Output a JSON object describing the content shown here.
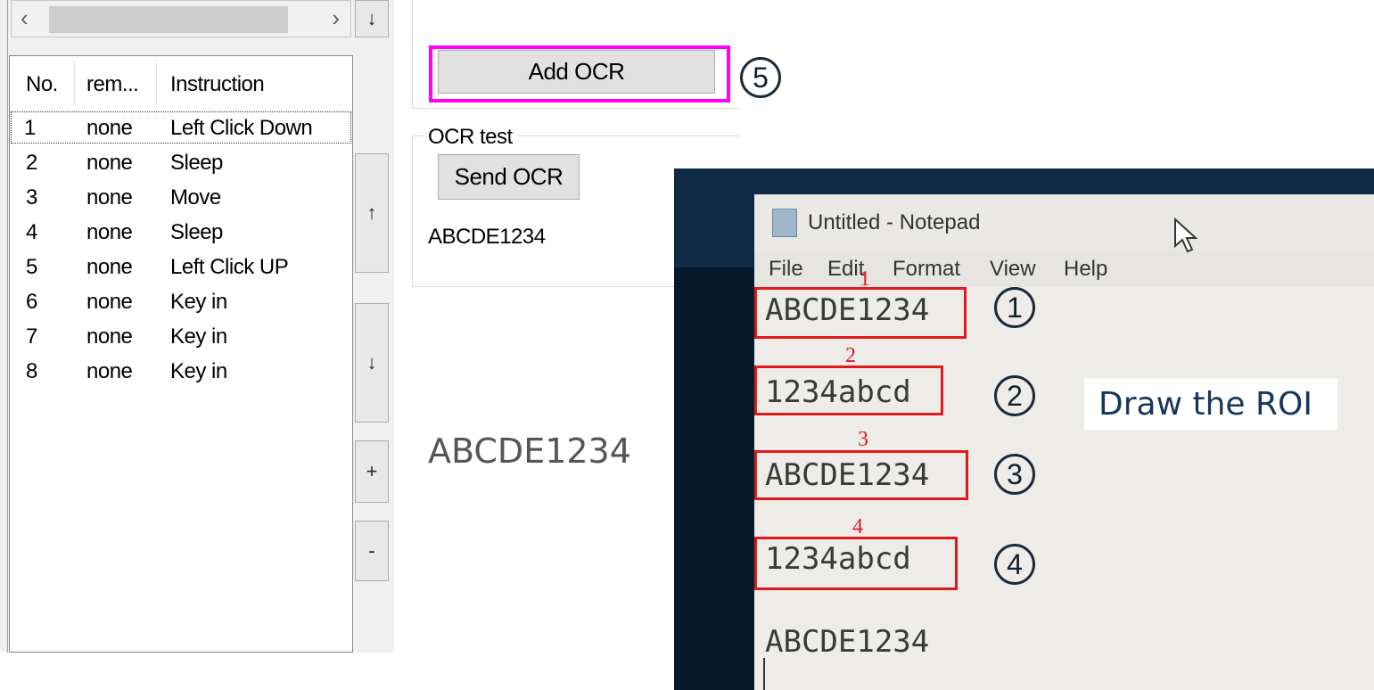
{
  "left_panel": {
    "hscroll": {
      "left_arrow": "‹",
      "right_arrow": "›"
    },
    "list": {
      "headers": [
        "No.",
        "rem...",
        "Instruction"
      ],
      "rows": [
        {
          "no": "1",
          "remark": "none",
          "instruction": "Left Click Down"
        },
        {
          "no": "2",
          "remark": "none",
          "instruction": "Sleep"
        },
        {
          "no": "3",
          "remark": "none",
          "instruction": "Move"
        },
        {
          "no": "4",
          "remark": "none",
          "instruction": "Sleep"
        },
        {
          "no": "5",
          "remark": "none",
          "instruction": "Left Click UP"
        },
        {
          "no": "6",
          "remark": "none",
          "instruction": "Key in"
        },
        {
          "no": "7",
          "remark": "none",
          "instruction": "Key in"
        },
        {
          "no": "8",
          "remark": "none",
          "instruction": "Key in"
        }
      ]
    },
    "side_buttons": {
      "top_down": "↓",
      "up": "↑",
      "down": "↓",
      "plus": "+",
      "minus": "-"
    }
  },
  "middle": {
    "add_ocr_label": "Add OCR",
    "step5": "5",
    "ocr_test_title": "OCR test",
    "send_ocr_label": "Send OCR",
    "ocr_result": "ABCDE1234",
    "big_preview": "ABCDE1234"
  },
  "notepad": {
    "title": "Untitled - Notepad",
    "menu": [
      "File",
      "Edit",
      "Format",
      "View",
      "Help"
    ],
    "lines": [
      "ABCDE1234",
      "1234abcd",
      "ABCDE1234",
      "1234abcd",
      "ABCDE1234"
    ],
    "roi_labels": [
      "1",
      "2",
      "3",
      "4"
    ],
    "step_numbers": [
      "1",
      "2",
      "3",
      "4"
    ],
    "draw_roi_label": "Draw the ROI"
  },
  "colors": {
    "highlight": "#ff00ff",
    "roi": "#e01a1a",
    "desktop": "#0e2a45"
  }
}
